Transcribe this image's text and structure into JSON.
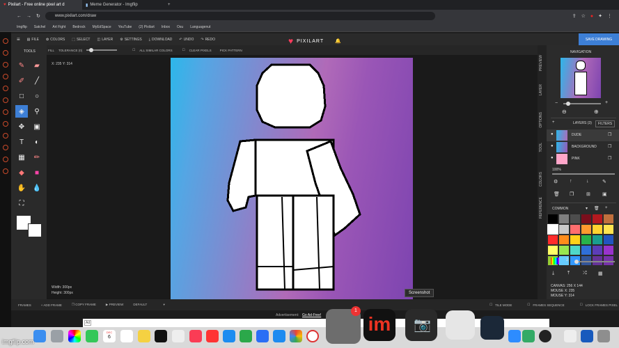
{
  "browser": {
    "tabs": [
      {
        "label": "Pixilart - Free online pixel art d"
      },
      {
        "label": "Meme Generator - Imgflip"
      }
    ],
    "url": "www.pixilart.com/draw",
    "bookmarks": [
      "Imgflip",
      "Satchel",
      "Art Fight",
      "Bedrock",
      "MyEdSpace",
      "YouTube",
      "(2) Pixilart",
      "Inbox",
      "Osu",
      "Languagenut"
    ]
  },
  "menu": {
    "items": [
      "FILE",
      "COLORS",
      "SELECT",
      "LAYER",
      "SETTINGS",
      "DOWNLOAD",
      "UNDO",
      "REDO"
    ],
    "logo": "PIXILART",
    "save": "SAVE DRAWING"
  },
  "tools": {
    "title": "TOOLS"
  },
  "options": {
    "fill": "FILL",
    "tolerance": "TOLERANCE (0)",
    "all_similar": "ALL SIMILAR COLORS",
    "clear_pixels": "CLEAR PIXELS",
    "pick_pattern": "PICK PATTERN"
  },
  "canvas_info": {
    "coords": "X: 235 Y: 314",
    "width": "Width: 300px",
    "height": "Height: 300px"
  },
  "right_tabs": [
    "PREVIEW",
    "LAYER",
    "OPTIONS",
    "TOOL",
    "COLORS",
    "REFERENCE"
  ],
  "navigation": {
    "title": "NAVIGATION"
  },
  "layers": {
    "title": "LAYERS (3)",
    "filters": "FILTERS",
    "items": [
      {
        "name": "DUDE"
      },
      {
        "name": "BACKGROUND"
      },
      {
        "name": "PINK"
      }
    ],
    "opacity": "100%"
  },
  "palette": {
    "name": "COMMON",
    "colors": [
      "#000000",
      "#7f7f7f",
      "#4d4d4d",
      "#7a0e1c",
      "#b5191f",
      "#c0703d",
      "#ffffff",
      "#c9c9c9",
      "#ff6e6e",
      "#ff9a2e",
      "#ffd330",
      "#ffe44f",
      "#ff2b2b",
      "#ff8c1a",
      "#ffd11a",
      "#28b34b",
      "#1a9e8f",
      "#2255c0",
      "#ffff66",
      "#99e650",
      "#4fd8c8",
      "#2f6fd8",
      "#5c3db8",
      "#9933cc",
      "#99cc33",
      "#66ccff",
      "#3399ff",
      "#335599",
      "#663399",
      "#7733aa"
    ],
    "brush_size": "2"
  },
  "status": {
    "canvas": "CANVAS: 256 X 144",
    "mouse_x": "MOUSE X: 235",
    "mouse_y": "MOUSE Y: 314"
  },
  "footer": {
    "frames": "FRAMES",
    "add_frame": "ADD FRAME",
    "copy_frame": "COPY FRAME",
    "preview": "PREVIEW",
    "default": "DEFAULT",
    "tile_mode": "TILE MODE",
    "frames_sequence": "FRAMES SEQUENCE",
    "lock_frames": "LOCK FRAMES PIXEL"
  },
  "ad": {
    "label": "Advertisement:",
    "link": "Go Ad-Free!",
    "tag": "Ad"
  },
  "tooltip": "Screenshot",
  "dock": {
    "calendar_month": "DEC",
    "calendar_day": "6",
    "badge": "1"
  },
  "watermark": "imgflip.com"
}
